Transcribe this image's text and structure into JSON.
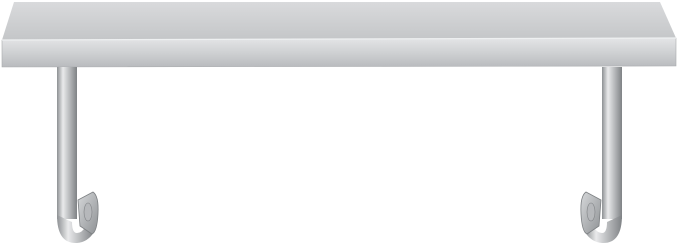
{
  "product": {
    "name": "stainless-steel-wall-shelf",
    "material_color": "#c9cbcd",
    "background": "#ffffff"
  }
}
